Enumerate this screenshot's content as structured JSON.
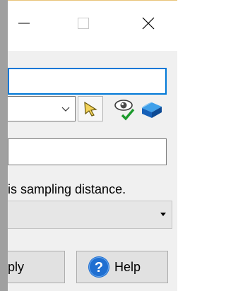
{
  "window": {
    "controls": {
      "minimize_icon": "minimize-icon",
      "maximize_icon": "maximize-icon",
      "close_icon": "close-icon"
    }
  },
  "form": {
    "name_input": {
      "value": ""
    },
    "target_combo": {
      "value": ""
    },
    "tools": {
      "pick_icon": "pointer-pick-icon",
      "eye_icon": "eye-check-icon",
      "cube_icon": "blue-solid-icon"
    },
    "value_input": {
      "value": ""
    },
    "hint_text": "is sampling distance.",
    "dropdown": {
      "value": ""
    }
  },
  "buttons": {
    "apply_label": "ply",
    "help_label": "Help"
  },
  "colors": {
    "focus_border": "#0078d7",
    "dialog_bg": "#f0f0f0",
    "help_blue": "#1f6fd1"
  }
}
